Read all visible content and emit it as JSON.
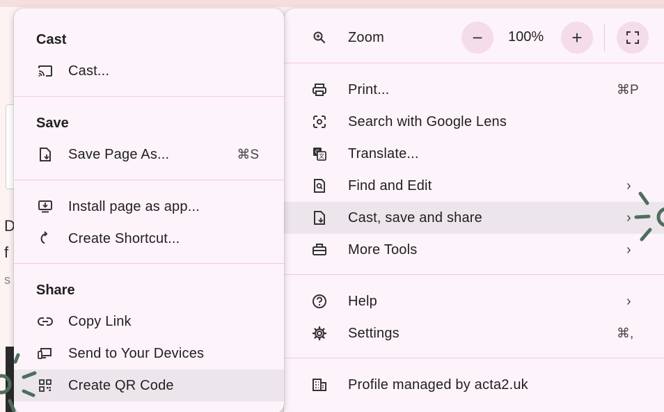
{
  "background": {
    "letters": [
      "D",
      "f",
      "s"
    ]
  },
  "left_menu": {
    "sections": {
      "cast": {
        "header": "Cast",
        "items": [
          {
            "label": "Cast...",
            "icon": "cast-icon"
          }
        ]
      },
      "save": {
        "header": "Save",
        "items": [
          {
            "label": "Save Page As...",
            "shortcut": "⌘S",
            "icon": "save-page-icon"
          }
        ]
      },
      "install": {
        "items": [
          {
            "label": "Install page as app...",
            "icon": "install-app-icon"
          },
          {
            "label": "Create Shortcut...",
            "icon": "shortcut-icon"
          }
        ]
      },
      "share": {
        "header": "Share",
        "items": [
          {
            "label": "Copy Link",
            "icon": "link-icon"
          },
          {
            "label": "Send to Your Devices",
            "icon": "devices-icon"
          },
          {
            "label": "Create QR Code",
            "icon": "qr-code-icon"
          }
        ]
      }
    }
  },
  "right_menu": {
    "zoom": {
      "label": "Zoom",
      "value": "100%",
      "minus": "−",
      "plus": "+"
    },
    "items": [
      {
        "label": "Print...",
        "shortcut": "⌘P",
        "icon": "printer-icon"
      },
      {
        "label": "Search with Google Lens",
        "icon": "google-lens-icon"
      },
      {
        "label": "Translate...",
        "icon": "translate-icon"
      },
      {
        "label": "Find and Edit",
        "chevron": "›",
        "icon": "find-edit-icon"
      },
      {
        "label": "Cast, save and share",
        "chevron": "›",
        "icon": "cast-save-share-icon"
      },
      {
        "label": "More Tools",
        "chevron": "›",
        "icon": "toolbox-icon"
      },
      {
        "label": "Help",
        "chevron": "›",
        "icon": "help-icon"
      },
      {
        "label": "Settings",
        "shortcut": "⌘,",
        "icon": "gear-icon"
      },
      {
        "label": "Profile managed by acta2.uk",
        "icon": "building-icon"
      }
    ]
  },
  "colors": {
    "menu_bg": "#fdf3fb",
    "separator": "#f3c9e6",
    "highlight": "#ece6ec",
    "accent_marks": "#4e6e5d"
  }
}
